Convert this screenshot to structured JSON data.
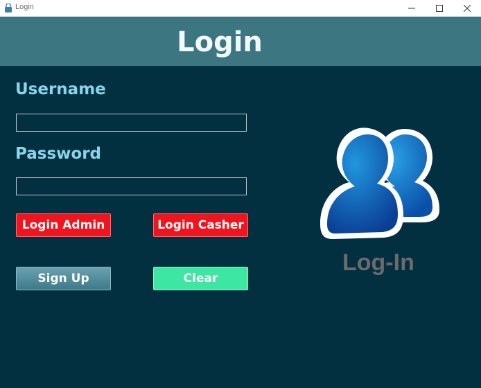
{
  "window": {
    "title": "Login",
    "controls": {
      "minimize_icon": "minimize-icon",
      "maximize_icon": "maximize-icon",
      "close_icon": "close-icon"
    }
  },
  "header": {
    "title": "Login"
  },
  "form": {
    "username_label": "Username",
    "username_value": "",
    "password_label": "Password",
    "password_value": ""
  },
  "buttons": {
    "login_admin": "Login Admin",
    "login_casher": "Login Casher",
    "sign_up": "Sign Up",
    "clear": "Clear"
  },
  "graphic": {
    "icon": "users-icon",
    "label": "Log-In"
  },
  "colors": {
    "background": "#023041",
    "header": "#3c7781",
    "label": "#8ad5ea",
    "login_buttons": "#f0141f",
    "sign_up_button": "#4f8c9b",
    "clear_button": "#3ee6a3",
    "logo_text": "#6b6b6b"
  }
}
